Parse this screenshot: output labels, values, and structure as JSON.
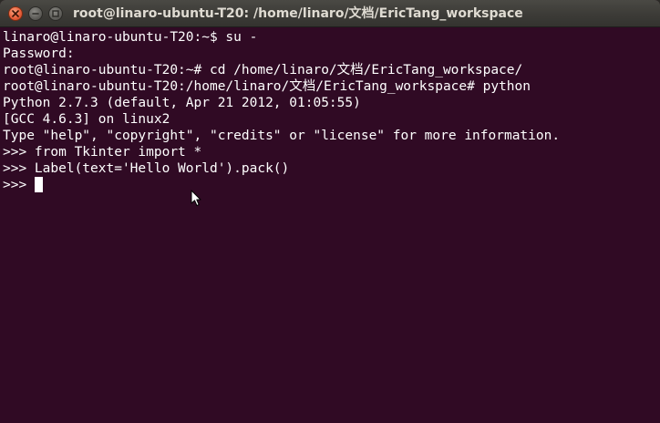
{
  "window": {
    "title": "root@linaro-ubuntu-T20: /home/linaro/文档/EricTang_workspace",
    "close_icon": "close-icon",
    "minimize_icon": "minimize-icon",
    "maximize_icon": "maximize-icon"
  },
  "terminal": {
    "lines": [
      "linaro@linaro-ubuntu-T20:~$ su -",
      "Password:",
      "root@linaro-ubuntu-T20:~# cd /home/linaro/文档/EricTang_workspace/",
      "root@linaro-ubuntu-T20:/home/linaro/文档/EricTang_workspace# python",
      "Python 2.7.3 (default, Apr 21 2012, 01:05:55)",
      "[GCC 4.6.3] on linux2",
      "Type \"help\", \"copyright\", \"credits\" or \"license\" for more information.",
      ">>> from Tkinter import *",
      ">>> Label(text='Hello World').pack()"
    ],
    "prompt": ">>> ",
    "background_color": "#300a24",
    "text_color": "#ffffff"
  }
}
